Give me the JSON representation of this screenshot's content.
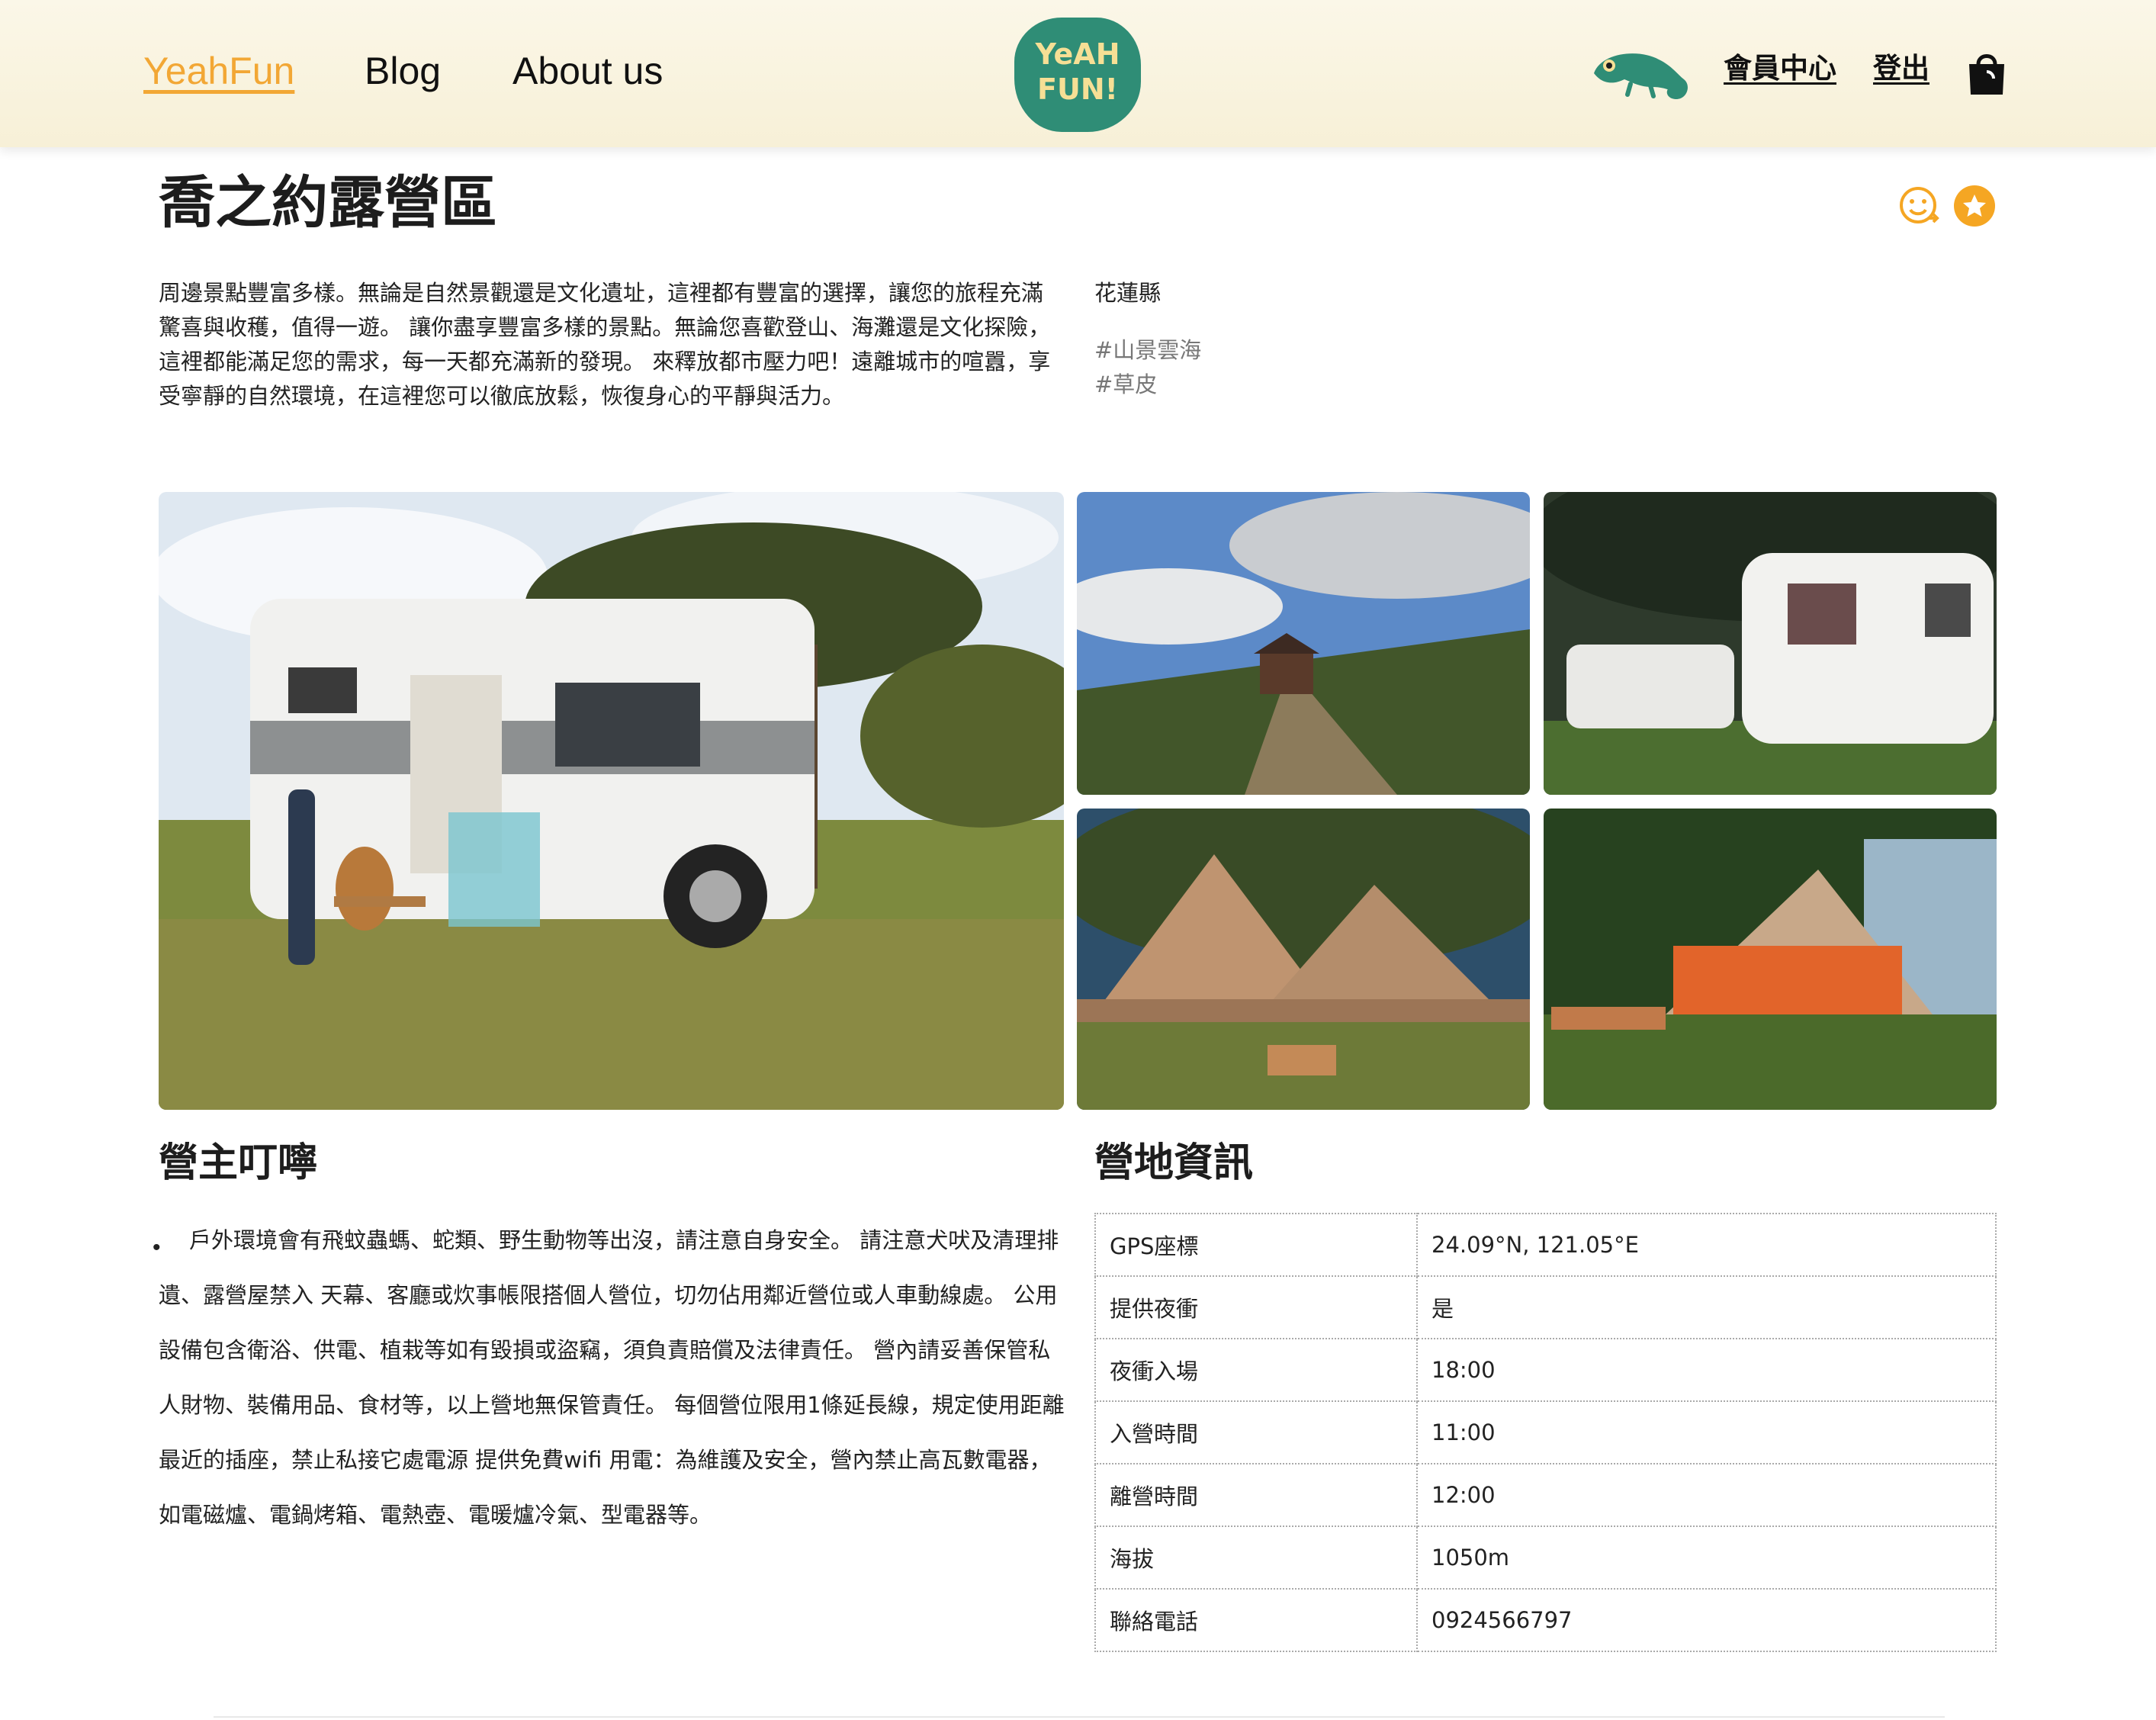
{
  "header": {
    "nav": {
      "home": "YeahFun",
      "blog": "Blog",
      "about": "About us"
    },
    "logo": {
      "line1": "YeAH",
      "line2": "FUN!"
    },
    "member_center": "會員中心",
    "logout": "登出"
  },
  "campsite": {
    "title": "喬之約露營區",
    "description": "周邊景點豐富多樣。無論是自然景觀還是文化遺址，這裡都有豐富的選擇，讓您的旅程充滿驚喜與收穫，值得一遊。 讓你盡享豐富多樣的景點。無論您喜歡登山、海灘還是文化探險，這裡都能滿足您的需求，每一天都充滿新的發現。 來釋放都市壓力吧！遠離城市的喧囂，享受寧靜的自然環境，在這裡您可以徹底放鬆，恢復身心的平靜與活力。",
    "county": "花蓮縣",
    "tags": [
      "#山景雲海",
      "#草皮"
    ]
  },
  "notes": {
    "title": "營主叮嚀",
    "text": "戶外環境會有飛蚊蟲螞、蛇類、野生動物等出沒，請注意自身安全。 請注意犬吠及清理排遺、露營屋禁入 天幕、客廳或炊事帳限搭個人營位，切勿佔用鄰近營位或人車動線處。 公用設備包含衛浴、供電、植栽等如有毀損或盜竊，須負責賠償及法律責任。 營內請妥善保管私人財物、裝備用品、食材等，以上營地無保管責任。 每個營位限用1條延長線，規定使用距離最近的插座，禁止私接它處電源 提供免費wifi 用電：為維護及安全，營內禁止高瓦數電器，如電磁爐、電鍋烤箱、電熱壺、電暖爐冷氣、型電器等。"
  },
  "info": {
    "title": "營地資訊",
    "rows": [
      {
        "label": "GPS座標",
        "value": "24.09°N, 121.05°E"
      },
      {
        "label": "提供夜衝",
        "value": "是"
      },
      {
        "label": "夜衝入場",
        "value": "18:00"
      },
      {
        "label": "入營時間",
        "value": "11:00"
      },
      {
        "label": "離營時間",
        "value": "12:00"
      },
      {
        "label": "海拔",
        "value": "1050m"
      },
      {
        "label": "聯絡電話",
        "value": "0924566797"
      }
    ]
  },
  "icons": {
    "chameleon": "chameleon-icon",
    "cart": "shopping-bag-icon",
    "share": "smiley-share-icon",
    "favorite": "star-icon"
  },
  "colors": {
    "accent": "#f2a735",
    "brand_green": "#2f8d76",
    "header_bg": "#f9f3df",
    "star": "#f5a623"
  }
}
